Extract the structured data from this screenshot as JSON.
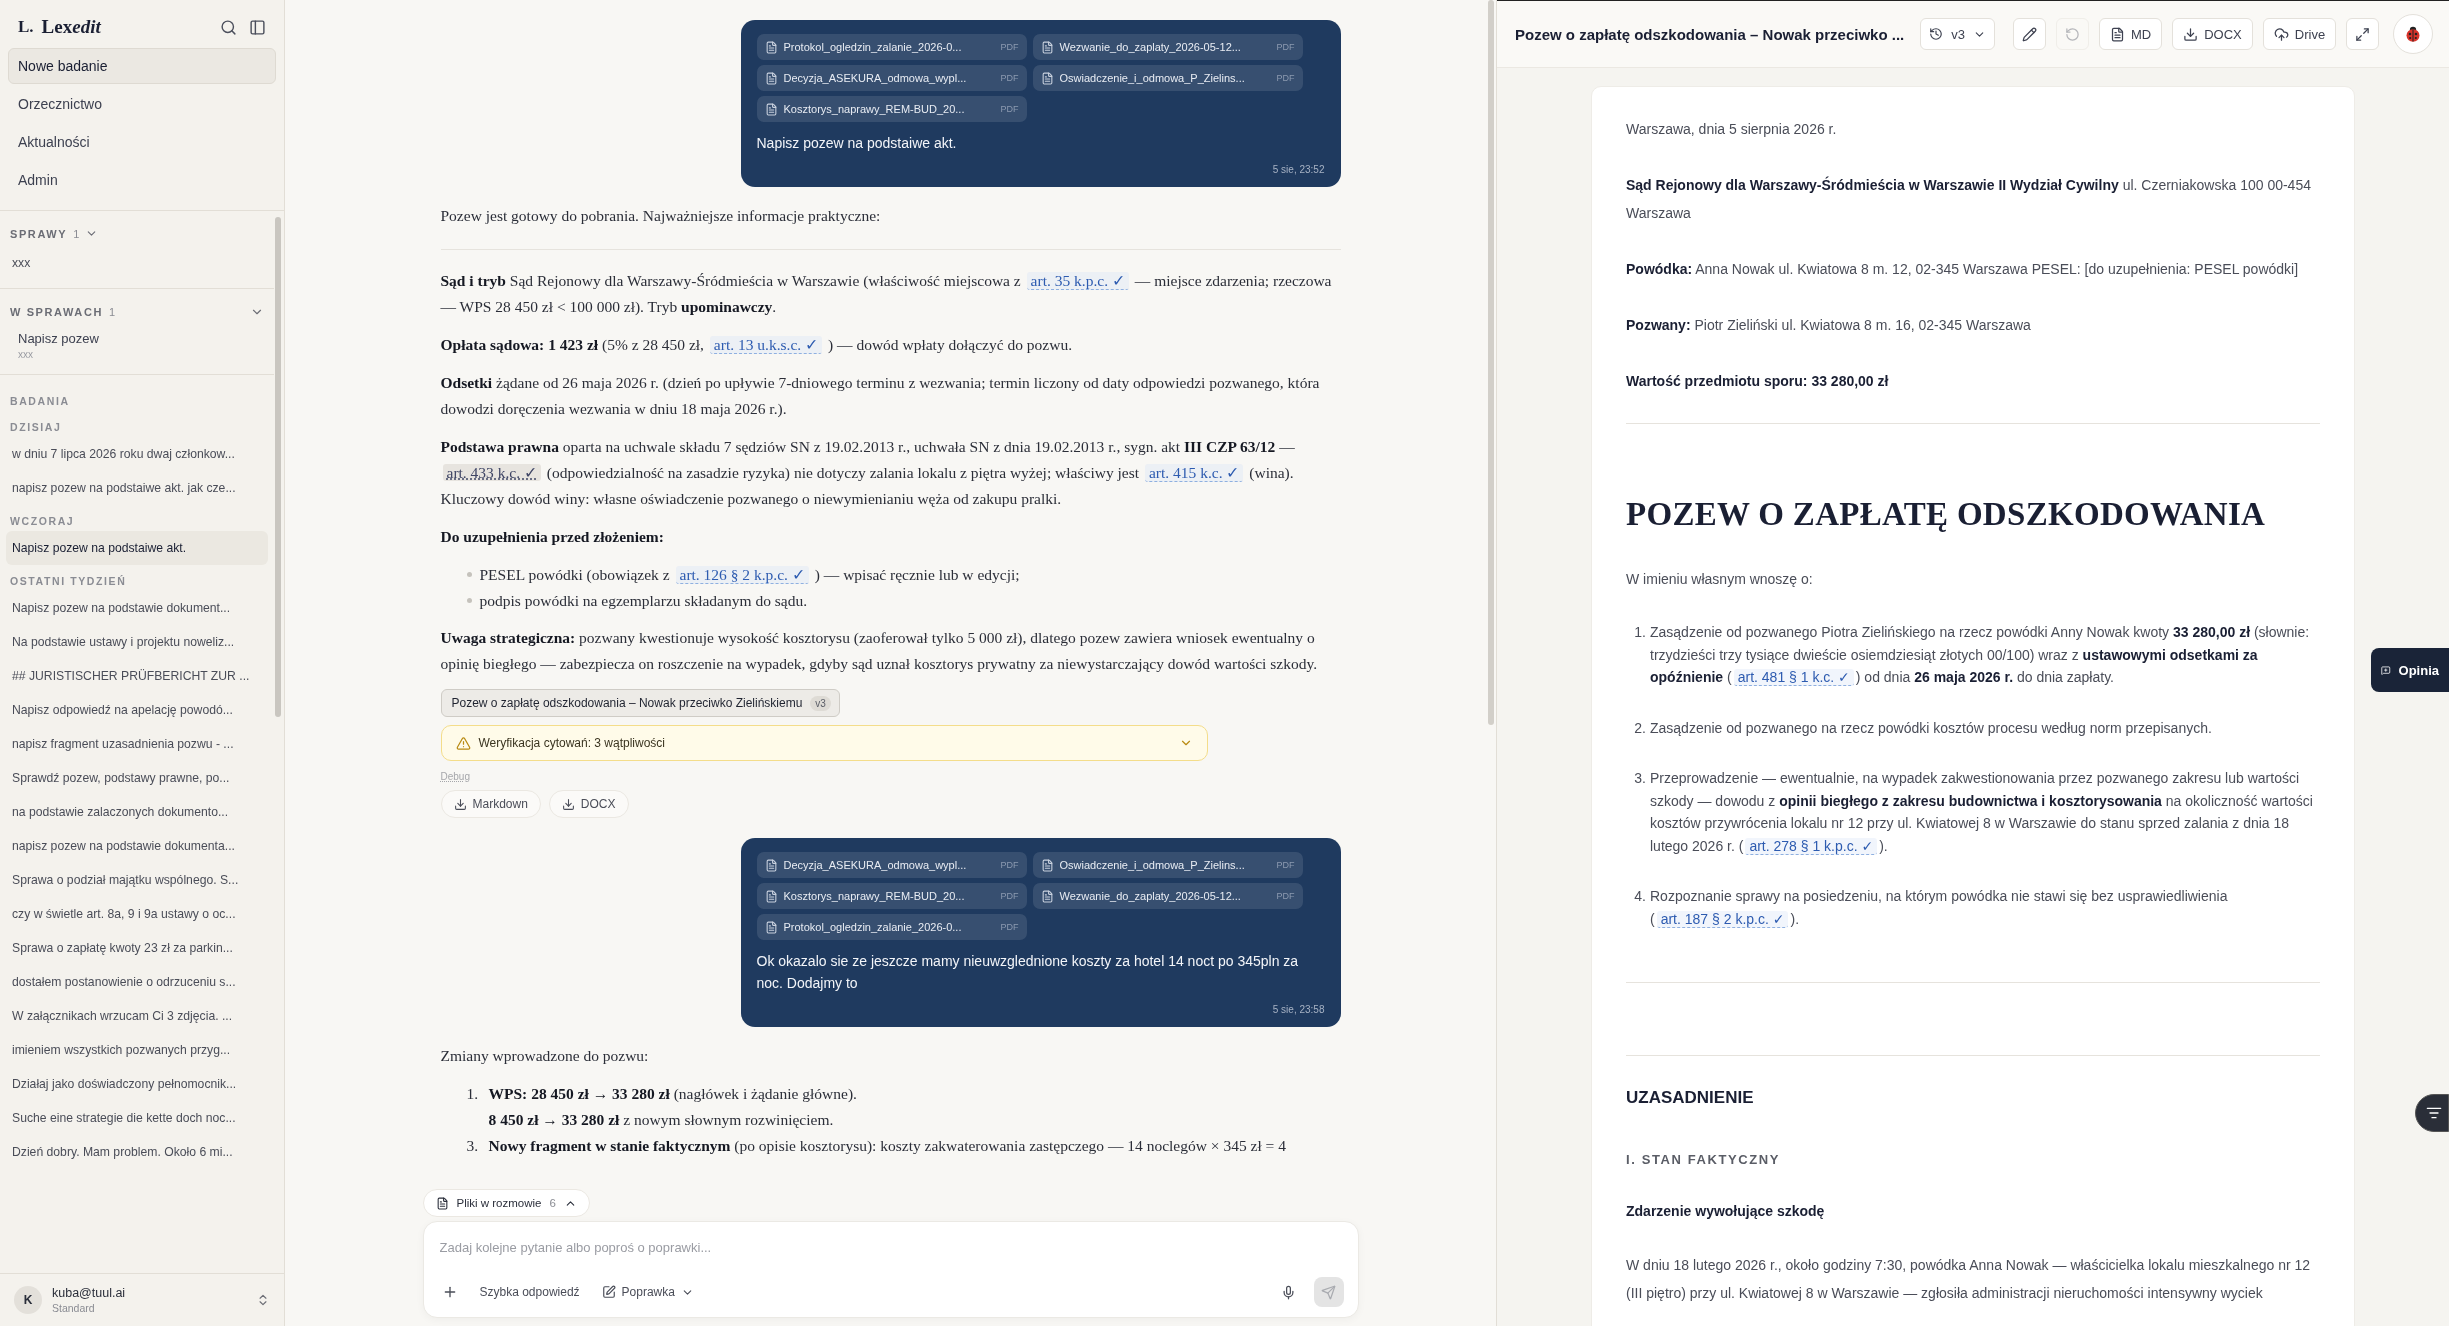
{
  "sidebar": {
    "logo": {
      "mark": "L.",
      "name": "Lex",
      "name_italic": "edit"
    },
    "nav": [
      {
        "label": "Nowe badanie",
        "selected": true
      },
      {
        "label": "Orzecznictwo",
        "selected": false
      },
      {
        "label": "Aktualności",
        "selected": false
      },
      {
        "label": "Admin",
        "selected": false
      }
    ],
    "cases": {
      "title": "SPRAWY",
      "count": "1",
      "expanded": true,
      "items": [
        "xxx"
      ]
    },
    "in_cases": {
      "title": "W SPRAWACH",
      "count": "1",
      "expanded": true,
      "items": [
        {
          "title": "Napisz pozew",
          "subtitle": "xxx"
        }
      ]
    },
    "research": {
      "title": "BADANIA",
      "groups": [
        {
          "label": "DZISIAJ",
          "items": [
            {
              "label": "w dniu 7 lipca 2026 roku dwaj członkow...",
              "selected": false
            },
            {
              "label": "napisz pozew na podstaiwe akt. jak cze...",
              "selected": false
            }
          ]
        },
        {
          "label": "WCZORAJ",
          "items": [
            {
              "label": "Napisz pozew na podstaiwe akt.",
              "selected": true
            }
          ]
        },
        {
          "label": "OSTATNI TYDZIEŃ",
          "items": [
            {
              "label": "Napisz pozew na podstawie dokument...",
              "selected": false
            },
            {
              "label": "Na podstawie ustawy i projektu noweliz...",
              "selected": false
            },
            {
              "label": "## JURISTISCHER PRÜFBERICHT ZUR ...",
              "selected": false
            },
            {
              "label": "Napisz odpowiedź na apelację powodó...",
              "selected": false
            },
            {
              "label": "napisz fragment uzasadnienia pozwu - ...",
              "selected": false
            },
            {
              "label": "Sprawdź pozew, podstawy prawne, po...",
              "selected": false
            },
            {
              "label": "na podstawie zalaczonych dokumento...",
              "selected": false
            },
            {
              "label": "napisz pozew na podstawie dokumenta...",
              "selected": false
            },
            {
              "label": "Sprawa o podział majątku wspólnego. S...",
              "selected": false
            },
            {
              "label": "czy w świetle art. 8a, 9 i 9a ustawy o oc...",
              "selected": false
            },
            {
              "label": "Sprawa o zapłatę kwoty 23 zł za parkin...",
              "selected": false
            },
            {
              "label": "dostałem postanowienie o odrzuceniu s...",
              "selected": false
            },
            {
              "label": "W załącznikach wrzucam Ci 3 zdjęcia. ...",
              "selected": false
            },
            {
              "label": "imieniem wszystkich pozwanych przyg...",
              "selected": false
            },
            {
              "label": "Działaj jako doświadczony pełnomocnik...",
              "selected": false
            },
            {
              "label": "Suche eine strategie die kette doch noc...",
              "selected": false
            },
            {
              "label": "Dzień dobry. Mam problem. Około 6 mi...",
              "selected": false
            }
          ]
        }
      ]
    },
    "user": {
      "initial": "K",
      "email": "kuba@tuul.ai",
      "plan": "Standard"
    }
  },
  "chat": {
    "messages": [
      {
        "kind": "user",
        "attachments": [
          {
            "name": "Protokol_ogledzin_zalanie_2026-0...",
            "type": "PDF"
          },
          {
            "name": "Wezwanie_do_zaplaty_2026-05-12...",
            "type": "PDF"
          },
          {
            "name": "Decyzja_ASEKURA_odmowa_wypl...",
            "type": "PDF"
          },
          {
            "name": "Oswiadczenie_i_odmowa_P_Zielins...",
            "type": "PDF"
          },
          {
            "name": "Kosztorys_naprawy_REM-BUD_20...",
            "type": "PDF"
          }
        ],
        "text": "Napisz pozew na podstaiwe akt.",
        "time": "5 sie, 23:52"
      },
      {
        "kind": "assistant",
        "blocks": [
          {
            "kind": "paragraph",
            "segments": [
              {
                "kind": "text",
                "text": "Pozew jest gotowy do pobrania. Najważniejsze informacje praktyczne:"
              }
            ]
          },
          {
            "kind": "rule"
          },
          {
            "kind": "paragraph",
            "segments": [
              {
                "kind": "text",
                "text": "**Sąd i tryb** Sąd Rejonowy dla Warszawy-Śródmieścia w Warszawie (właściwość miejscowa z "
              },
              {
                "kind": "cite",
                "text": "art. 35 k.p.c. ✓",
                "doubtful": false
              },
              {
                "kind": "text",
                "text": " — miejsce zdarzenia; rzeczowa — WPS 28 450 zł < 100 000 zł). Tryb **upominawczy**."
              }
            ]
          },
          {
            "kind": "paragraph",
            "segments": [
              {
                "kind": "text",
                "text": "**Opłata sądowa: 1 423 zł** (5% z 28 450 zł, "
              },
              {
                "kind": "cite",
                "text": "art. 13 u.k.s.c. ✓",
                "doubtful": false
              },
              {
                "kind": "text",
                "text": " ) — dowód wpłaty dołączyć do pozwu."
              }
            ]
          },
          {
            "kind": "paragraph",
            "segments": [
              {
                "kind": "text",
                "text": "**Odsetki** żądane od 26 maja 2026 r. (dzień po upływie 7-dniowego terminu z wezwania; termin liczony od daty odpowiedzi pozwanego, która dowodzi doręczenia wezwania w dniu 18 maja 2026 r.)."
              }
            ]
          },
          {
            "kind": "paragraph",
            "segments": [
              {
                "kind": "text",
                "text": "**Podstawa prawna** oparta na uchwale składu 7 sędziów SN z 19.02.2013 r., uchwała SN z dnia 19.02.2013 r., sygn. akt **III CZP 63/12** — "
              },
              {
                "kind": "cite",
                "text": "art. 433 k.c. ✓",
                "doubtful": true
              },
              {
                "kind": "text",
                "text": " (odpowiedzialność na zasadzie ryzyka) nie dotyczy zalania lokalu z piętra wyżej; właściwy jest "
              },
              {
                "kind": "cite",
                "text": "art. 415 k.c. ✓",
                "doubtful": false
              },
              {
                "kind": "text",
                "text": " (wina). Kluczowy dowód winy: własne oświadczenie pozwanego o niewymienianiu węża od zakupu pralki."
              }
            ]
          },
          {
            "kind": "heading",
            "text": "Do uzupełnienia przed złożeniem:"
          },
          {
            "kind": "bullets",
            "items": [
              {
                "segments": [
                  {
                    "kind": "text",
                    "text": "PESEL powódki (obowiązek z "
                  },
                  {
                    "kind": "cite",
                    "text": "art. 126 § 2 k.p.c. ✓",
                    "doubtful": false
                  },
                  {
                    "kind": "text",
                    "text": " ) — wpisać ręcznie lub w edycji;"
                  }
                ]
              },
              {
                "segments": [
                  {
                    "kind": "text",
                    "text": "podpis powódki na egzemplarzu składanym do sądu."
                  }
                ]
              }
            ]
          },
          {
            "kind": "paragraph",
            "segments": [
              {
                "kind": "text",
                "text": "**Uwaga strategiczna:** pozwany kwestionuje wysokość kosztorysu (zaoferował tylko 5 000 zł), dlatego pozew zawiera wniosek ewentualny o opinię biegłego — zabezpiecza on roszczenie na wypadek, gdyby sąd uznał kosztorys prywatny za niewystarczający dowód wartości szkody."
              }
            ]
          }
        ],
        "document": {
          "title": "Pozew o zapłatę odszkodowania – Nowak przeciwko Zielińskiemu",
          "version": "v3"
        },
        "verification": {
          "label": "Weryfikacja cytowań: 3 wątpliwości",
          "expanded": false
        },
        "debug": "Debug",
        "exports": [
          {
            "kind": "download",
            "label": "Markdown"
          },
          {
            "kind": "download",
            "label": "DOCX"
          }
        ]
      },
      {
        "kind": "user",
        "attachments": [
          {
            "name": "Decyzja_ASEKURA_odmowa_wypl...",
            "type": "PDF"
          },
          {
            "name": "Oswiadczenie_i_odmowa_P_Zielins...",
            "type": "PDF"
          },
          {
            "name": "Kosztorys_naprawy_REM-BUD_20...",
            "type": "PDF"
          },
          {
            "name": "Wezwanie_do_zaplaty_2026-05-12...",
            "type": "PDF"
          },
          {
            "name": "Protokol_ogledzin_zalanie_2026-0...",
            "type": "PDF"
          }
        ],
        "text": "Ok okazalo sie ze jeszcze mamy nieuwzglednione koszty za hotel  14 noct po 345pln za noc. Dodajmy to",
        "time": "5 sie, 23:58"
      },
      {
        "kind": "assistant",
        "blocks": [
          {
            "kind": "paragraph",
            "segments": [
              {
                "kind": "text",
                "text": "Zmiany wprowadzone do pozwu:"
              }
            ]
          },
          {
            "kind": "numbered",
            "items": [
              {
                "number": "1.",
                "segments": [
                  {
                    "kind": "text",
                    "text": "**WPS: 28 450 zł → 33 280 zł** (nagłówek i żądanie główne)."
                  }
                ]
              },
              {
                "segments": [
                  {
                    "kind": "text",
                    "text": "**8 450 zł → 33 280 zł** z nowym słownym rozwinięciem."
                  }
                ]
              },
              {
                "number": "3.",
                "segments": [
                  {
                    "kind": "text",
                    "text": "**Nowy fragment w stanie faktycznym** (po opisie kosztorysu): koszty zakwaterowania zastępczego — 14 noclegów × 345 zł = 4"
                  }
                ]
              }
            ]
          }
        ]
      }
    ],
    "files": {
      "label": "Pliki w rozmowie",
      "count": "6",
      "expanded": false
    },
    "composer": {
      "placeholder": "Zadaj kolejne pytanie albo poproś o poprawki...",
      "quick": "Szybka odpowiedź",
      "mode": "Poprawka",
      "send_enabled": false
    }
  },
  "document": {
    "title": "Pozew o zapłatę odszkodowania – Nowak przeciwko ...",
    "version": "v3",
    "tools": [
      {
        "kind": "edit",
        "disabled": false
      },
      {
        "kind": "undo",
        "disabled": true
      },
      {
        "kind": "md",
        "label": "MD",
        "disabled": false
      },
      {
        "kind": "docx",
        "label": "DOCX",
        "disabled": false
      },
      {
        "kind": "drive",
        "label": "Drive",
        "disabled": false
      },
      {
        "kind": "expand",
        "disabled": false
      }
    ],
    "blocks": [
      {
        "kind": "paragraph",
        "segments": [
          {
            "kind": "text",
            "text": "Warszawa, dnia 5 sierpnia 2026 r."
          }
        ]
      },
      {
        "kind": "paragraph",
        "segments": [
          {
            "kind": "text",
            "text": "**Sąd Rejonowy dla Warszawy-Śródmieścia w Warszawie II Wydział Cywilny** ul. Czerniakowska 100 00-454 Warszawa"
          }
        ]
      },
      {
        "kind": "paragraph",
        "segments": [
          {
            "kind": "text",
            "text": "**Powódka:** Anna Nowak ul. Kwiatowa 8 m. 12, 02-345 Warszawa PESEL: [do uzupełnienia: PESEL powódki]"
          }
        ]
      },
      {
        "kind": "paragraph",
        "segments": [
          {
            "kind": "text",
            "text": "**Pozwany:** Piotr Zieliński ul. Kwiatowa 8 m. 16, 02-345 Warszawa"
          }
        ]
      },
      {
        "kind": "strong",
        "text": "Wartość przedmiotu sporu: 33 280,00 zł"
      },
      {
        "kind": "rule"
      },
      {
        "kind": "title",
        "text": "POZEW O ZAPŁATĘ ODSZKODOWANIA"
      },
      {
        "kind": "paragraph",
        "segments": [
          {
            "kind": "text",
            "text": "W imieniu własnym wnoszę o:"
          }
        ]
      },
      {
        "kind": "numbered",
        "items": [
          {
            "number": "1.",
            "segments": [
              {
                "kind": "text",
                "text": "Zasądzenie od pozwanego Piotra Zielińskiego na rzecz powódki Anny Nowak kwoty **33 280,00 zł** (słownie: trzydzieści trzy tysiące dwieście osiemdziesiąt złotych 00/100) wraz z **ustawowymi odsetkami za opóźnienie** ("
              },
              {
                "kind": "cite",
                "text": "art. 481 § 1 k.c. ✓",
                "doubtful": false
              },
              {
                "kind": "text",
                "text": ") od dnia **26 maja 2026 r.** do dnia zapłaty."
              }
            ]
          },
          {
            "number": "2.",
            "segments": [
              {
                "kind": "text",
                "text": "Zasądzenie od pozwanego na rzecz powódki kosztów procesu według norm przepisanych."
              }
            ]
          },
          {
            "number": "3.",
            "segments": [
              {
                "kind": "text",
                "text": "Przeprowadzenie — ewentualnie, na wypadek zakwestionowania przez pozwanego zakresu lub wartości szkody — dowodu z **opinii biegłego z zakresu budownictwa i kosztorysowania** na okoliczność wartości kosztów przywrócenia lokalu nr 12 przy ul. Kwiatowej 8 w Warszawie do stanu sprzed zalania z dnia 18 lutego 2026 r. ("
              },
              {
                "kind": "cite",
                "text": "art. 278 § 1 k.p.c. ✓",
                "doubtful": false
              },
              {
                "kind": "text",
                "text": ")."
              }
            ]
          },
          {
            "number": "4.",
            "segments": [
              {
                "kind": "text",
                "text": "Rozpoznanie sprawy na posiedzeniu, na którym powódka nie stawi się bez usprawiedliwienia ("
              },
              {
                "kind": "cite",
                "text": "art. 187 § 2 k.p.c. ✓",
                "doubtful": false
              },
              {
                "kind": "text",
                "text": ")."
              }
            ]
          }
        ]
      },
      {
        "kind": "rule"
      },
      {
        "kind": "rule"
      },
      {
        "kind": "section",
        "text": "UZASADNIENIE"
      },
      {
        "kind": "subsection",
        "text": "I. STAN FAKTYCZNY"
      },
      {
        "kind": "subheading",
        "text": "Zdarzenie wywołujące szkodę"
      },
      {
        "kind": "paragraph",
        "segments": [
          {
            "kind": "text",
            "text": "W dniu 18 lutego 2026 r., około godziny 7:30, powódka Anna Nowak — właścicielka lokalu mieszkalnego nr 12 (III piętro) przy ul. Kwiatowej 8 w Warszawie — zgłosiła administracji nieruchomości intensywny wyciek"
          }
        ]
      }
    ]
  },
  "feedback": {
    "label": "Opinia"
  }
}
